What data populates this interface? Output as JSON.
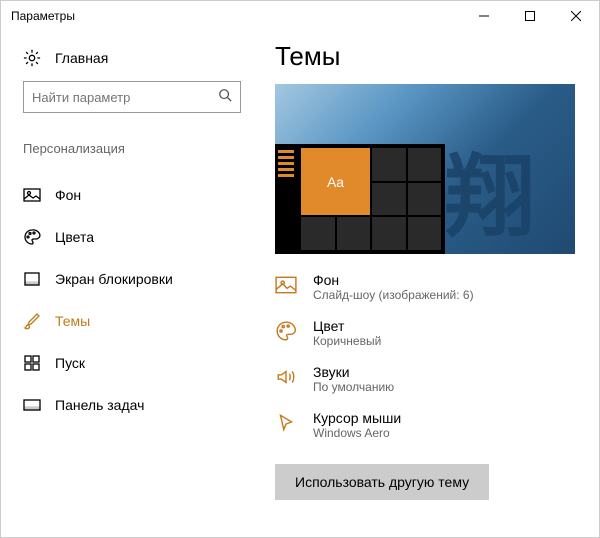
{
  "window": {
    "title": "Параметры"
  },
  "home": {
    "label": "Главная"
  },
  "search": {
    "placeholder": "Найти параметр"
  },
  "section": {
    "header": "Персонализация"
  },
  "nav": {
    "items": [
      {
        "label": "Фон"
      },
      {
        "label": "Цвета"
      },
      {
        "label": "Экран блокировки"
      },
      {
        "label": "Темы"
      },
      {
        "label": "Пуск"
      },
      {
        "label": "Панель задач"
      }
    ]
  },
  "page": {
    "title": "Темы"
  },
  "preview": {
    "tile_label": "Aa",
    "kanji": "翔"
  },
  "settings": {
    "bg": {
      "title": "Фон",
      "sub": "Слайд-шоу (изображений: 6)"
    },
    "color": {
      "title": "Цвет",
      "sub": "Коричневый"
    },
    "sound": {
      "title": "Звуки",
      "sub": "По умолчанию"
    },
    "cursor": {
      "title": "Курсор мыши",
      "sub": "Windows Aero"
    }
  },
  "action": {
    "label": "Использовать другую тему"
  },
  "colors": {
    "accent": "#c47a1e"
  }
}
